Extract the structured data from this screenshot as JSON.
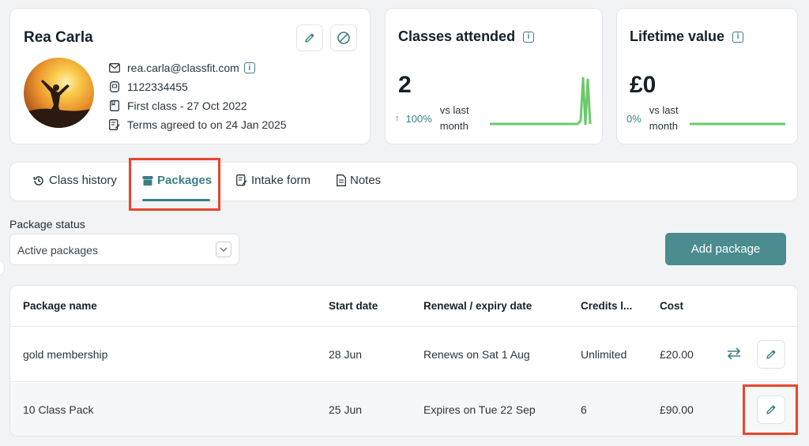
{
  "colors": {
    "accent": "#3b7f86",
    "button": "#4a8c90",
    "highlight": "#e8452c",
    "spark": "#6cc96a"
  },
  "profile": {
    "name": "Rea Carla",
    "email": "rea.carla@classfit.com",
    "phone": "1122334455",
    "first_class": "First class - 27 Oct 2022",
    "terms": "Terms agreed to on 24 Jan 2025",
    "info_badge": "i"
  },
  "stats": {
    "classes": {
      "title": "Classes attended",
      "value": "2",
      "change": "100%",
      "vs": "vs last month",
      "trend_arrow": "↑"
    },
    "lifetime": {
      "title": "Lifetime value",
      "value": "£0",
      "change": "0%",
      "vs": "vs last month"
    }
  },
  "tabs": [
    {
      "label": "Class history",
      "icon": "history-icon"
    },
    {
      "label": "Packages",
      "icon": "package-icon"
    },
    {
      "label": "Intake form",
      "icon": "form-icon"
    },
    {
      "label": "Notes",
      "icon": "notes-icon"
    }
  ],
  "filter": {
    "label": "Package status",
    "value": "Active packages"
  },
  "add_button": "Add package",
  "table": {
    "headers": [
      "Package name",
      "Start date",
      "Renewal / expiry date",
      "Credits l...",
      "Cost"
    ],
    "rows": [
      [
        "gold membership",
        "28 Jun",
        "Renews on Sat 1 Aug",
        "Unlimited",
        "£20.00"
      ],
      [
        "10 Class Pack",
        "25 Jun",
        "Expires on Tue 22 Sep",
        "6",
        "£90.00"
      ]
    ]
  }
}
